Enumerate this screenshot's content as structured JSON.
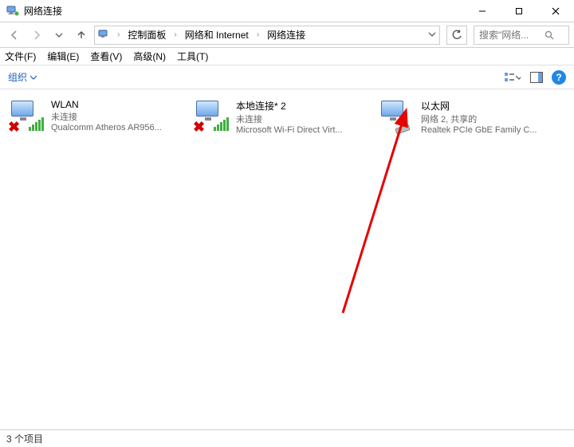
{
  "window": {
    "title": "网络连接",
    "min_label": "最小化",
    "max_label": "最大化",
    "close_label": "关闭"
  },
  "nav": {
    "back_label": "后退",
    "forward_label": "前进",
    "up_label": "上一级"
  },
  "breadcrumb": {
    "items": [
      "控制面板",
      "网络和 Internet",
      "网络连接"
    ]
  },
  "search": {
    "placeholder": "搜索\"网络..."
  },
  "menu": {
    "file": "文件(F)",
    "edit": "编辑(E)",
    "view": "查看(V)",
    "advanced": "高级(N)",
    "tools": "工具(T)"
  },
  "toolbar": {
    "organize": "组织",
    "view_label": "更改视图",
    "pane_label": "预览窗格",
    "help_label": "帮助"
  },
  "connections": [
    {
      "name": "WLAN",
      "status": "未连接",
      "device": "Qualcomm Atheros AR956...",
      "type": "wifi",
      "disconnected": true
    },
    {
      "name": "本地连接* 2",
      "status": "未连接",
      "device": "Microsoft Wi-Fi Direct Virt...",
      "type": "wifi",
      "disconnected": true
    },
    {
      "name": "以太网",
      "status": "网络 2, 共享的",
      "device": "Realtek PCIe GbE Family C...",
      "type": "ethernet",
      "disconnected": false
    }
  ],
  "statusbar": {
    "count_text": "3 个项目"
  }
}
